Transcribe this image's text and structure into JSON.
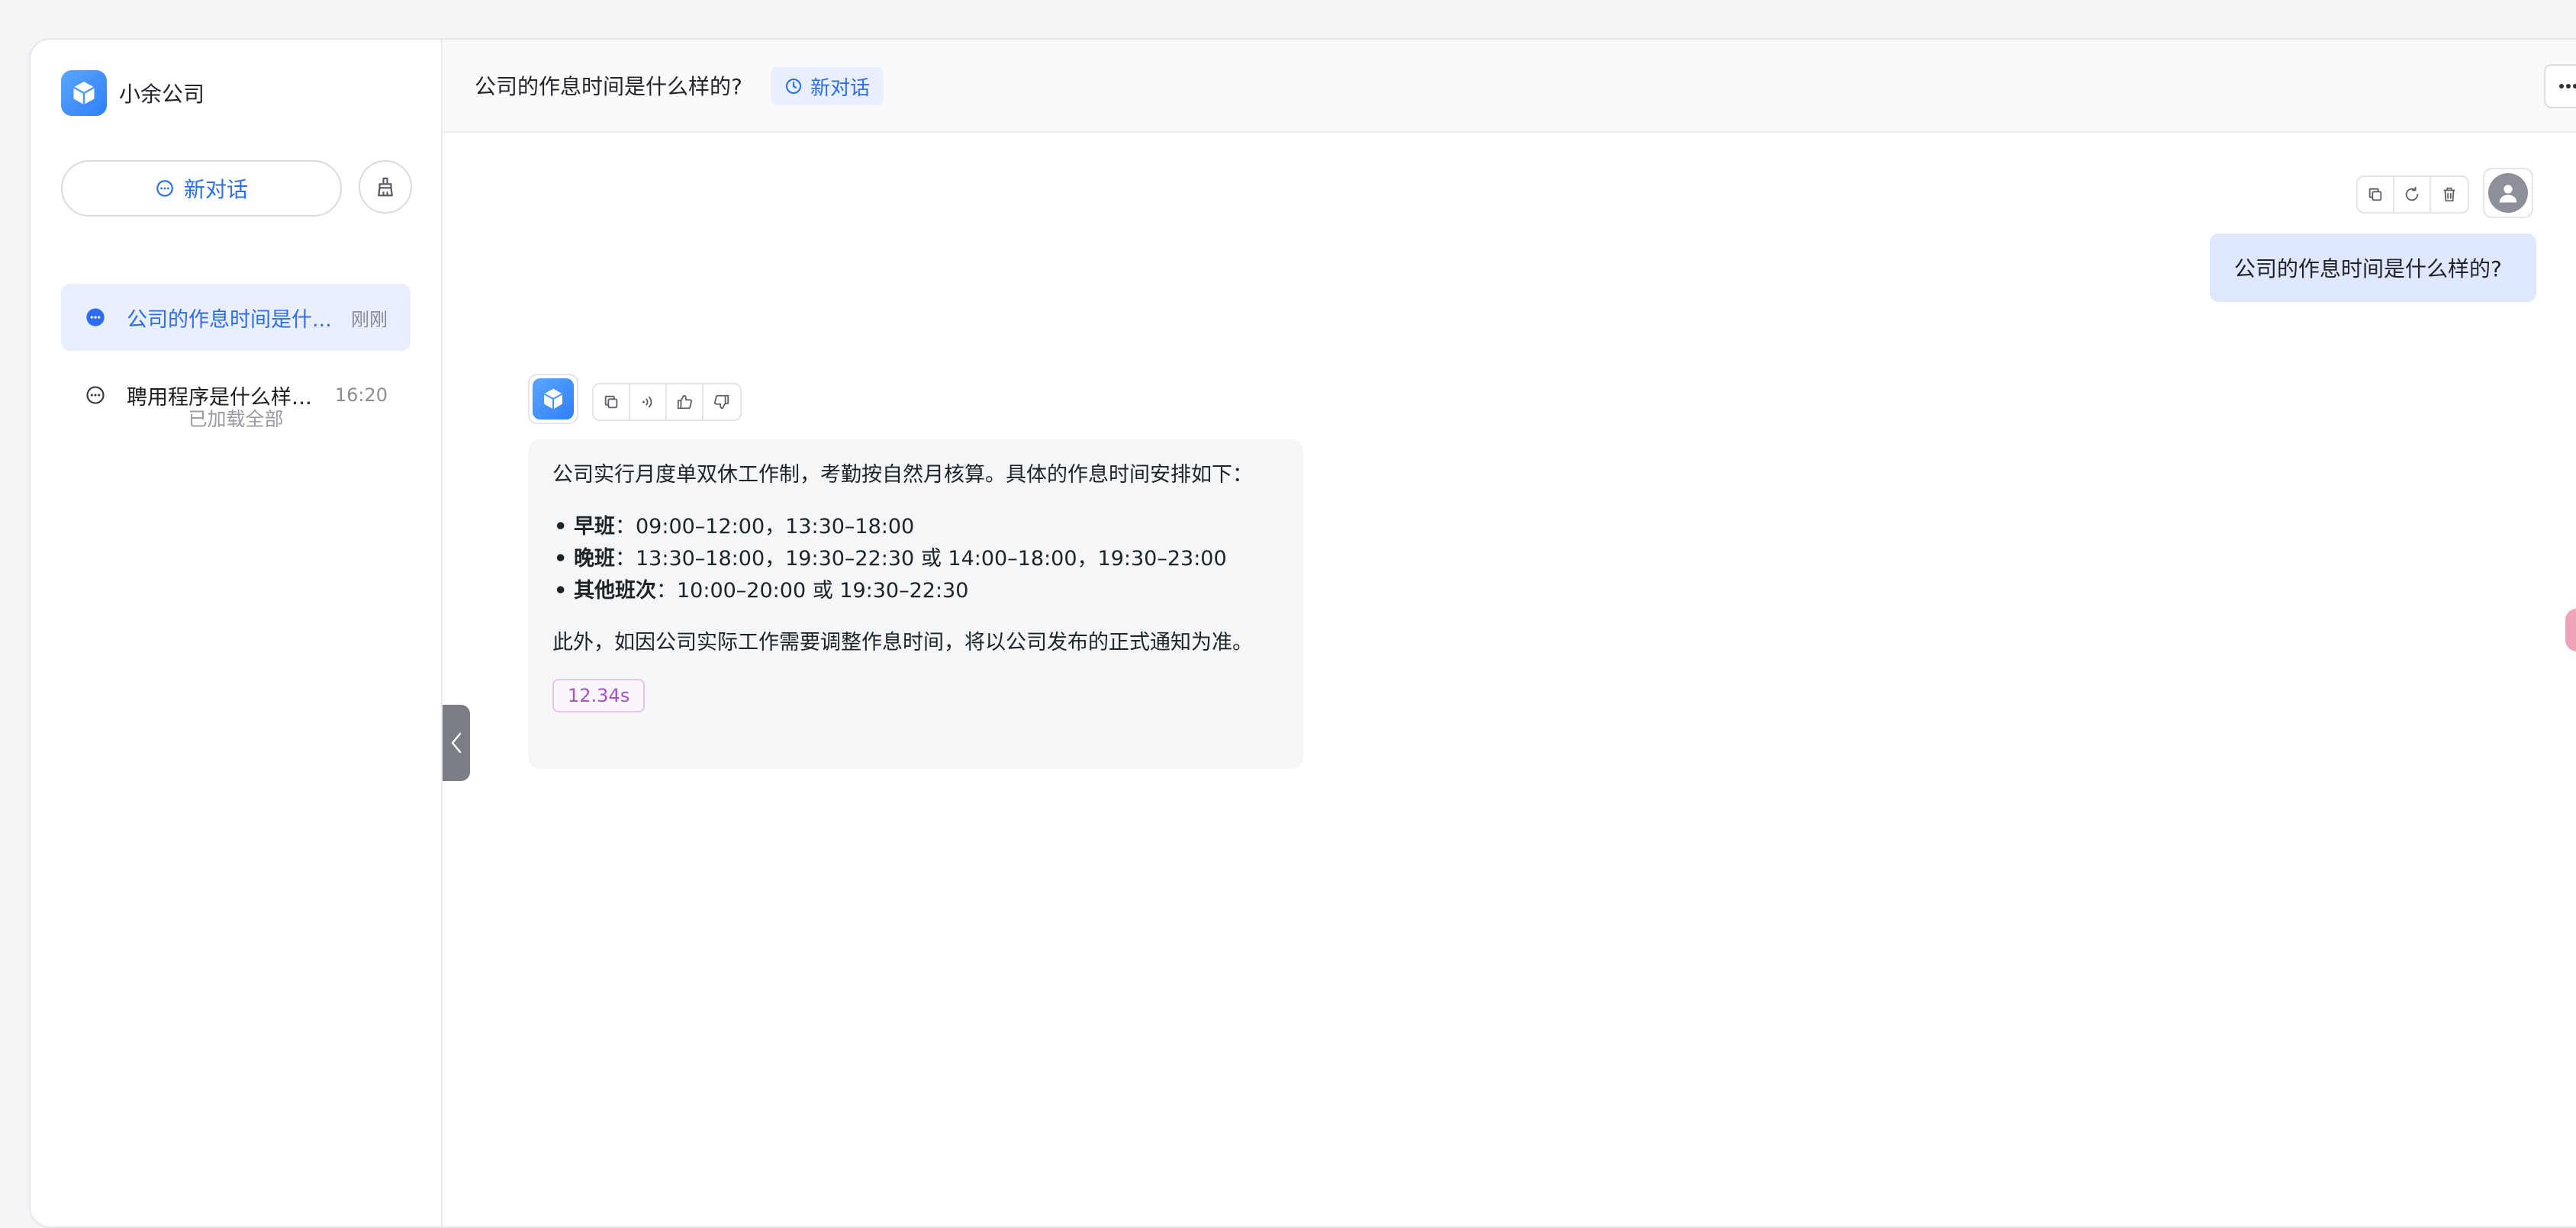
{
  "brand": {
    "name": "小余公司"
  },
  "sidebar": {
    "new_chat_label": "新对话",
    "history": [
      {
        "title": "公司的作息时间是什么样的？",
        "display_title": "公司的作息时间是什...",
        "time": "刚刚",
        "active": true
      },
      {
        "title": "聘用程序是什么样的？",
        "display_title": "聘用程序是什么样的...",
        "time": "16:20",
        "active": false
      }
    ],
    "loaded_all": "已加载全部"
  },
  "header": {
    "title": "公司的作息时间是什么样的?",
    "tag_label": "新对话"
  },
  "conversation": {
    "user_message": "公司的作息时间是什么样的?",
    "bot_message": {
      "intro": "公司实行月度单双休工作制，考勤按自然月核算。具体的作息时间安排如下：",
      "shifts": [
        {
          "name": "早班",
          "sep": "：",
          "hours": "09:00–12:00，13:30–18:00"
        },
        {
          "name": "晚班",
          "sep": "：",
          "hours": "13:30–18:00，19:30–22:30 或 14:00–18:00，19:30–23:00"
        },
        {
          "name": "其他班次",
          "sep": "：",
          "hours": "10:00–20:00 或 19:30–22:30"
        }
      ],
      "note": "此外，如因公司实际工作需要调整作息时间，将以公司发布的正式通知为准。",
      "elapsed": "12.34s"
    }
  },
  "icons": {
    "brand": "cube-logo-icon",
    "new_chat": "chat-bubble-icon",
    "clean": "broom-icon",
    "history_active": "chat-bubble-filled-icon",
    "history": "chat-bubble-icon",
    "clock": "clock-icon",
    "more": "more-horizontal-icon",
    "copy": "copy-icon",
    "regenerate": "refresh-icon",
    "delete": "trash-icon",
    "speak": "speaker-icon",
    "like": "thumbs-up-icon",
    "dislike": "thumbs-down-icon",
    "collapse": "chevron-left-icon",
    "user": "user-avatar-icon"
  },
  "colors": {
    "accent": "#2b6ef2",
    "active_bg": "#e9efff",
    "user_bubble": "#dfe8ff",
    "bot_bubble": "#f5f6f8",
    "elapsed_badge": "#a752c7"
  }
}
